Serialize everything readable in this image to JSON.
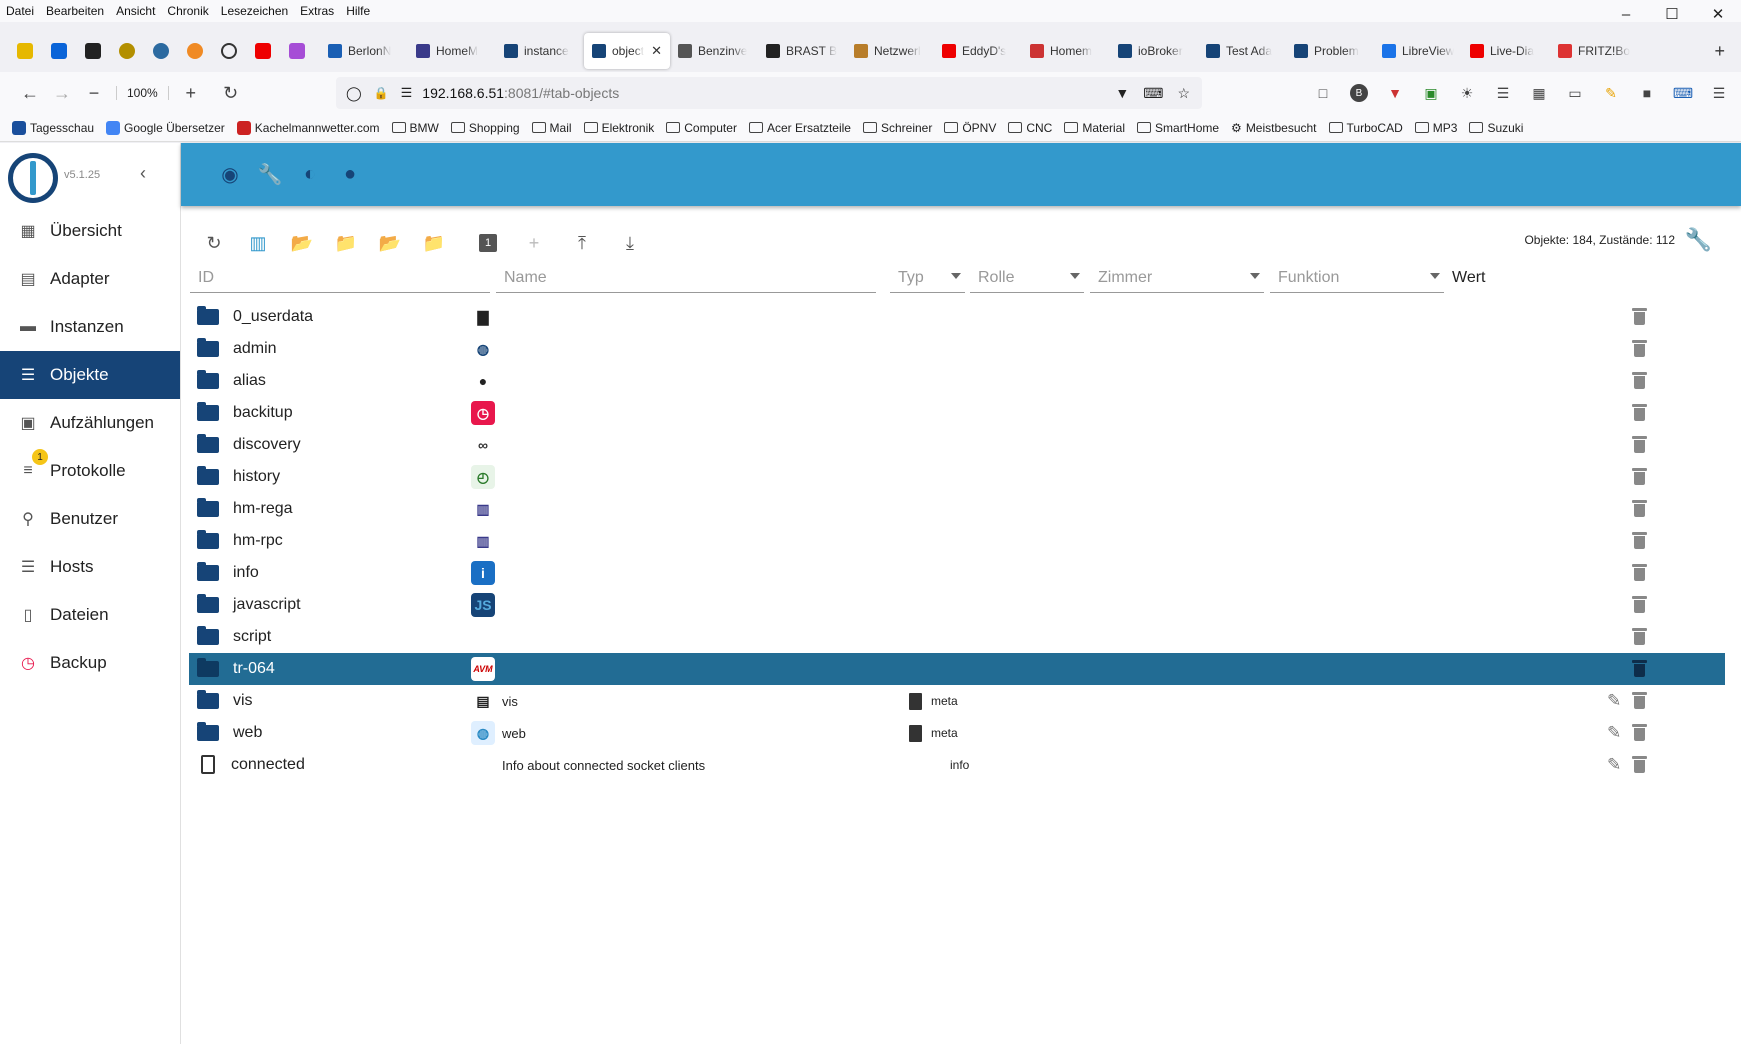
{
  "browser": {
    "menu": [
      "Datei",
      "Bearbeiten",
      "Ansicht",
      "Chronik",
      "Lesezeichen",
      "Extras",
      "Hilfe"
    ],
    "tabs": [
      {
        "label": "BerlonN",
        "color": "#1a5fb4"
      },
      {
        "label": "HomeM",
        "color": "#3a3a8a"
      },
      {
        "label": "instance",
        "color": "#164477"
      },
      {
        "label": "object",
        "color": "#164477",
        "active": true
      },
      {
        "label": "Benzinve",
        "color": "#555"
      },
      {
        "label": "BRAST B",
        "color": "#222"
      },
      {
        "label": "Netzwerl",
        "color": "#b87d2a"
      },
      {
        "label": "EddyD's",
        "color": "#e00"
      },
      {
        "label": "Homem",
        "color": "#c33"
      },
      {
        "label": "ioBroker",
        "color": "#164477"
      },
      {
        "label": "Test Ada",
        "color": "#164477"
      },
      {
        "label": "Problem",
        "color": "#164477"
      },
      {
        "label": "LibreView",
        "color": "#1a73e8"
      },
      {
        "label": "Live-Dia",
        "color": "#e00"
      },
      {
        "label": "FRITZ!Bo",
        "color": "#d33"
      }
    ],
    "zoom": "100%",
    "url_host": "192.168.6.51",
    "url_path": ":8081/#tab-objects",
    "bookmarks": [
      {
        "label": "Tagesschau",
        "type": "site",
        "color": "#1a4f9c"
      },
      {
        "label": "Google Übersetzer",
        "type": "site",
        "color": "#4285f4"
      },
      {
        "label": "Kachelmannwetter.com",
        "type": "site",
        "color": "#c22"
      },
      {
        "label": "BMW",
        "type": "folder"
      },
      {
        "label": "Shopping",
        "type": "folder"
      },
      {
        "label": "Mail",
        "type": "folder"
      },
      {
        "label": "Elektronik",
        "type": "folder"
      },
      {
        "label": "Computer",
        "type": "folder"
      },
      {
        "label": "Acer Ersatzteile",
        "type": "folder"
      },
      {
        "label": "Schreiner",
        "type": "folder"
      },
      {
        "label": "ÖPNV",
        "type": "folder"
      },
      {
        "label": "CNC",
        "type": "folder"
      },
      {
        "label": "Material",
        "type": "folder"
      },
      {
        "label": "SmartHome",
        "type": "folder"
      },
      {
        "label": "Meistbesucht",
        "type": "gear"
      },
      {
        "label": "TurboCAD",
        "type": "folder"
      },
      {
        "label": "MP3",
        "type": "folder"
      },
      {
        "label": "Suzuki",
        "type": "folder"
      }
    ]
  },
  "app": {
    "version": "v5.1.25",
    "nav": [
      {
        "label": "Übersicht",
        "icon": "grid-icon"
      },
      {
        "label": "Adapter",
        "icon": "store-icon"
      },
      {
        "label": "Instanzen",
        "icon": "instances-icon"
      },
      {
        "label": "Objekte",
        "icon": "list-icon",
        "active": true
      },
      {
        "label": "Aufzählungen",
        "icon": "enum-icon"
      },
      {
        "label": "Protokolle",
        "icon": "log-icon",
        "badge": "1"
      },
      {
        "label": "Benutzer",
        "icon": "user-icon"
      },
      {
        "label": "Hosts",
        "icon": "hosts-icon"
      },
      {
        "label": "Dateien",
        "icon": "files-icon"
      },
      {
        "label": "Backup",
        "icon": "backup-icon"
      }
    ],
    "counts": "Objekte: 184, Zustände: 112",
    "filters": {
      "id": "ID",
      "name": "Name",
      "typ": "Typ",
      "rolle": "Rolle",
      "zimmer": "Zimmer",
      "funktion": "Funktion",
      "wert": "Wert"
    },
    "rows": [
      {
        "id": "0_userdata",
        "kind": "folder",
        "icon": "image-icon",
        "name": "",
        "type": ""
      },
      {
        "id": "admin",
        "kind": "folder",
        "icon": "iobroker-icon",
        "name": "",
        "type": ""
      },
      {
        "id": "alias",
        "kind": "folder",
        "icon": "bulb-icon",
        "name": "",
        "type": ""
      },
      {
        "id": "backitup",
        "kind": "folder",
        "icon": "backitup-icon",
        "name": "",
        "type": ""
      },
      {
        "id": "discovery",
        "kind": "folder",
        "icon": "binoculars-icon",
        "name": "",
        "type": ""
      },
      {
        "id": "history",
        "kind": "folder",
        "icon": "clock-icon",
        "name": "",
        "type": ""
      },
      {
        "id": "hm-rega",
        "kind": "folder",
        "icon": "homematic-icon",
        "name": "",
        "type": ""
      },
      {
        "id": "hm-rpc",
        "kind": "folder",
        "icon": "homematic-icon",
        "name": "",
        "type": ""
      },
      {
        "id": "info",
        "kind": "folder",
        "icon": "info-icon",
        "name": "",
        "type": ""
      },
      {
        "id": "javascript",
        "kind": "folder",
        "icon": "js-icon",
        "name": "",
        "type": ""
      },
      {
        "id": "script",
        "kind": "folder",
        "icon": "",
        "name": "",
        "type": ""
      },
      {
        "id": "tr-064",
        "kind": "folder",
        "icon": "avm-icon",
        "name": "",
        "type": "",
        "selected": true
      },
      {
        "id": "vis",
        "kind": "folder",
        "icon": "document-icon",
        "name": "vis",
        "type": "meta",
        "edit": true
      },
      {
        "id": "web",
        "kind": "folder",
        "icon": "web-icon",
        "name": "web",
        "type": "meta",
        "edit": true
      },
      {
        "id": "connected",
        "kind": "file",
        "icon": "",
        "name": "Info about connected socket clients",
        "type": "info",
        "edit": true
      }
    ]
  }
}
